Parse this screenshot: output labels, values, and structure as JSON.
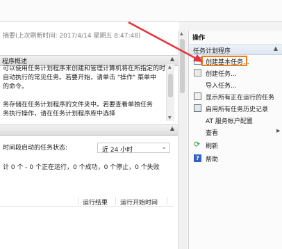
{
  "status_line": "摘要(上次刷新时间: 2017/4/14 星期五 8:47:48)",
  "overview": {
    "title": "程序概述",
    "lines": [
      "可以使用任务计划程序来创建和管理计算机将在所指定的时",
      "自动执行的常见任务。若要开始，请单击 \"操作\" 菜单中",
      "的命令。",
      "",
      "务存储在任务计划程序的文件夹中。若要查看单独任务",
      "务执行操作，请在任务计划程序库中选择"
    ]
  },
  "status_section": {
    "label": "时间段启动的任务状态:",
    "select_value": "近 24 小时",
    "summary": "计 0 个 - 0 个正在运行，0 个成功，0 个停止，0 个失败"
  },
  "table": {
    "columns": [
      "运行结果",
      "运行开始时间"
    ]
  },
  "actions_pane": {
    "title": "操作",
    "group": "任务计划程序",
    "items": [
      {
        "label": "创建基本任务...",
        "icon": "create-basic-task-icon"
      },
      {
        "label": "创建任务...",
        "icon": "create-task-icon"
      },
      {
        "label": "导入任务...",
        "icon": ""
      },
      {
        "label": "显示所有正在运行的任务",
        "icon": "running-tasks-icon"
      },
      {
        "label": "启用所有任务历史记录",
        "icon": "history-icon"
      },
      {
        "label": "AT 服务帐户配置",
        "icon": ""
      },
      {
        "label": "查看",
        "icon": "",
        "submenu": true
      },
      {
        "label": "刷新",
        "icon": "refresh-icon"
      },
      {
        "label": "帮助",
        "icon": "help-icon"
      }
    ]
  },
  "colors": {
    "highlight": "#ef7f1a",
    "annotation_arrow": "#e8313a"
  }
}
